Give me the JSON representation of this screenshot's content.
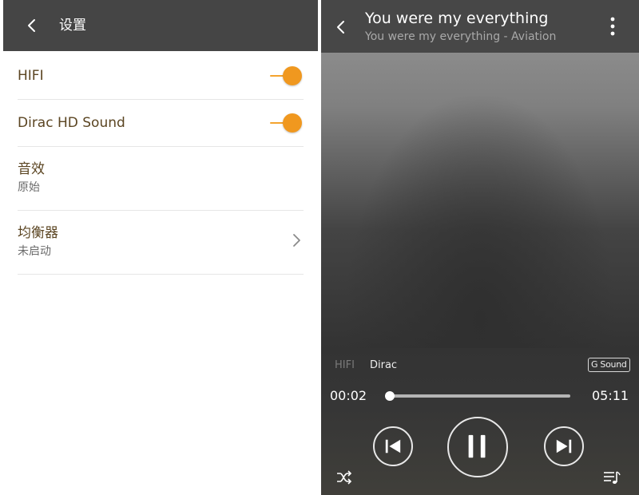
{
  "settings": {
    "title": "设置",
    "items": [
      {
        "label": "HIFI",
        "toggle": true
      },
      {
        "label": "Dirac HD Sound",
        "toggle": true
      },
      {
        "label": "音效",
        "value": "原始"
      },
      {
        "label": "均衡器",
        "value": "未启动"
      }
    ]
  },
  "player": {
    "title": "You were my everything",
    "subtitle": "You were my everything - Aviation",
    "chips": {
      "hifi": "HIFI",
      "dirac": "Dirac",
      "gsound": "G Sound"
    },
    "current_time": "00:02",
    "total_time": "05:11",
    "progress": 0.006
  },
  "colors": {
    "header_bg": "#454545",
    "accent": "#f0981f",
    "label_text": "#5b4522"
  },
  "icons": [
    "back-arrow-icon",
    "more-vertical-icon",
    "chevron-right-icon",
    "skip-previous-icon",
    "pause-icon",
    "skip-next-icon",
    "shuffle-icon",
    "playlist-icon"
  ]
}
